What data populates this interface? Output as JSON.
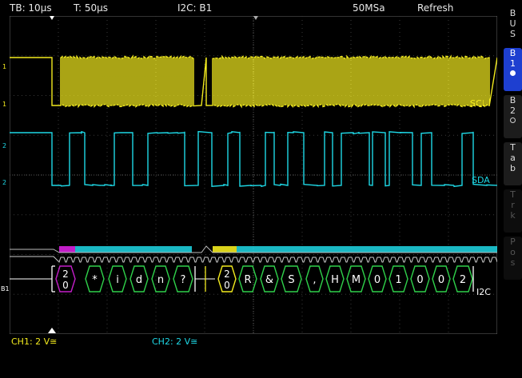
{
  "topbar": {
    "timebase": "TB: 10µs",
    "trigger_time": "T: 50µs",
    "trigger_source": "I2C: B1",
    "sample_rate": "50MSa",
    "acq_mode": "Refresh"
  },
  "channels": {
    "ch1_label": "SCL",
    "ch2_label": "SDA",
    "bus_label": "B1",
    "bus_protocol": "I2C",
    "ch1_scale": "CH1: 2 V≅",
    "ch2_scale": "CH2: 2 V≅",
    "ch1_marker_top": "1",
    "ch1_marker_bottom": "1",
    "ch2_marker_top": "2",
    "ch2_marker_bottom": "2"
  },
  "bus_frames": [
    {
      "kind": "address",
      "text_top": "2",
      "text_bottom": "0"
    },
    {
      "kind": "data",
      "text": "*"
    },
    {
      "kind": "data",
      "text": "i"
    },
    {
      "kind": "data",
      "text": "d"
    },
    {
      "kind": "data",
      "text": "n"
    },
    {
      "kind": "data",
      "text": "?"
    },
    {
      "kind": "address",
      "text_top": "2",
      "text_bottom": "0"
    },
    {
      "kind": "data",
      "text": "R"
    },
    {
      "kind": "data",
      "text": "&"
    },
    {
      "kind": "data",
      "text": "S"
    },
    {
      "kind": "data",
      "text": ","
    },
    {
      "kind": "data",
      "text": "H"
    },
    {
      "kind": "data",
      "text": "M"
    },
    {
      "kind": "data",
      "text": "0"
    },
    {
      "kind": "data",
      "text": "1"
    },
    {
      "kind": "data",
      "text": "0"
    },
    {
      "kind": "data",
      "text": "0"
    },
    {
      "kind": "data",
      "text": "2"
    }
  ],
  "sidebar": {
    "bus_menu": "BUS",
    "b1": "B1",
    "b2": "B2",
    "table": "Tab",
    "track": "Trk",
    "pos": "Pos"
  },
  "colors": {
    "ch1": "#f2ea1e",
    "ch2": "#1ed8e6",
    "bus_address": "#c31ec8",
    "bus_data": "#2fd04a",
    "bus_text": "#ffffff",
    "grid": "#3a3a3a",
    "sidebar_active": "#1e3fd0"
  }
}
